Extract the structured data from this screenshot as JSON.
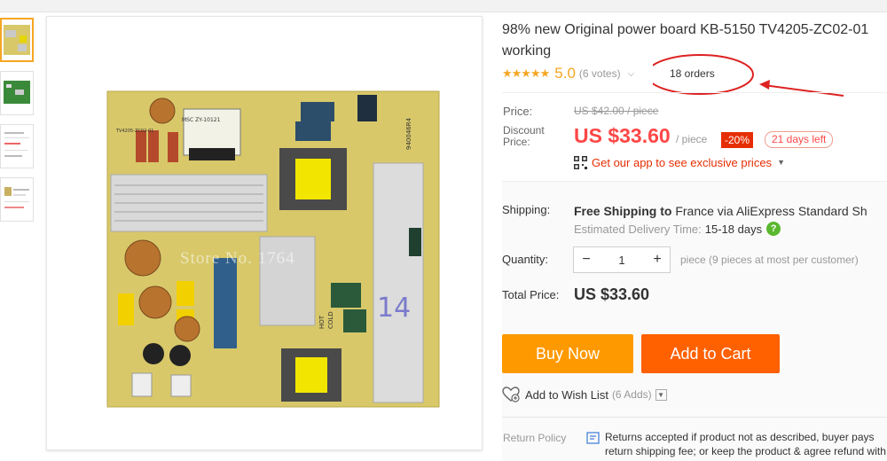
{
  "product": {
    "title": "98% new Original power board KB-5150 TV4205-ZC02-01 working",
    "stars_icon": "★★★★★",
    "rating": "5.0",
    "votes": "(6 votes)",
    "orders_annotation": "18 orders",
    "main_image_watermark": "Store No. 1764",
    "board_labels": {
      "model": "TV4205-ZC02-01",
      "code": "940046R4",
      "hot": "HOT",
      "cold": "COLD",
      "handwritten": "14",
      "transformer": "MSC ZY-10121"
    }
  },
  "pricing": {
    "price_label": "Price:",
    "old_price": "US $42.00 / piece",
    "discount_price_label": "Discount Price:",
    "discount_price": "US $33.60",
    "per_piece": "/ piece",
    "discount_badge": "-20%",
    "days_left": "21 days left",
    "app_promo": "Get our app to see exclusive prices",
    "qr_icon": "qr-code-icon",
    "accent_color": "#ff4747"
  },
  "shipping": {
    "label": "Shipping:",
    "free_prefix": "Free Shipping to",
    "destination": " France via AliExpress Standard Sh",
    "delivery_label": "Estimated Delivery Time:",
    "delivery_value": "15-18 days",
    "help_icon": "?"
  },
  "quantity": {
    "label": "Quantity:",
    "minus": "−",
    "value": "1",
    "plus": "+",
    "info": "piece (9 pieces at most per customer)"
  },
  "total": {
    "label": "Total Price:",
    "value": "US $33.60"
  },
  "actions": {
    "buy_now": "Buy Now",
    "add_to_cart": "Add to Cart",
    "wish_list": "Add to Wish List",
    "wish_count": "(6 Adds)",
    "buy_color": "#ff9900",
    "cart_color": "#ff6000"
  },
  "returns": {
    "label": "Return Policy",
    "text": "Returns accepted if product not as described, buyer pays return shipping fee; or keep the product & agree refund with seller."
  }
}
